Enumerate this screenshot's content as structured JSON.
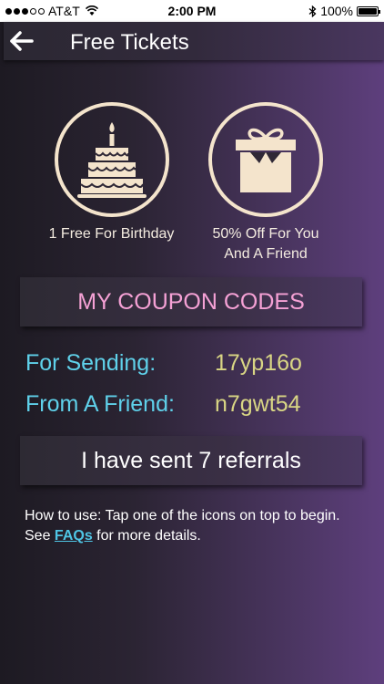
{
  "status_bar": {
    "carrier": "AT&T",
    "time": "2:00 PM",
    "battery": "100%",
    "battery_level": 1.0
  },
  "nav": {
    "title": "Free Tickets",
    "back_icon": "arrow-left-icon"
  },
  "offers": [
    {
      "label": "1 Free For Birthday",
      "icon": "birthday-cake-icon"
    },
    {
      "label_line1": "50% Off For You",
      "label_line2": "And A Friend",
      "icon": "gift-box-icon"
    }
  ],
  "coupons": {
    "title": "MY COUPON CODES",
    "sending_label": "For Sending:",
    "sending_code": "17yp16o",
    "friend_label": "From A Friend:",
    "friend_code": "n7gwt54"
  },
  "referral": {
    "text": "I have sent 7 referrals"
  },
  "help": {
    "prefix": "How to use: Tap one of the icons on top to begin. See ",
    "link": "FAQs",
    "suffix": " for more details."
  },
  "colors": {
    "accent_pink": "#f5a1d5",
    "accent_cyan": "#5fd1ea",
    "code_yellow": "#d9d684",
    "icon_cream": "#f4e4cc"
  }
}
